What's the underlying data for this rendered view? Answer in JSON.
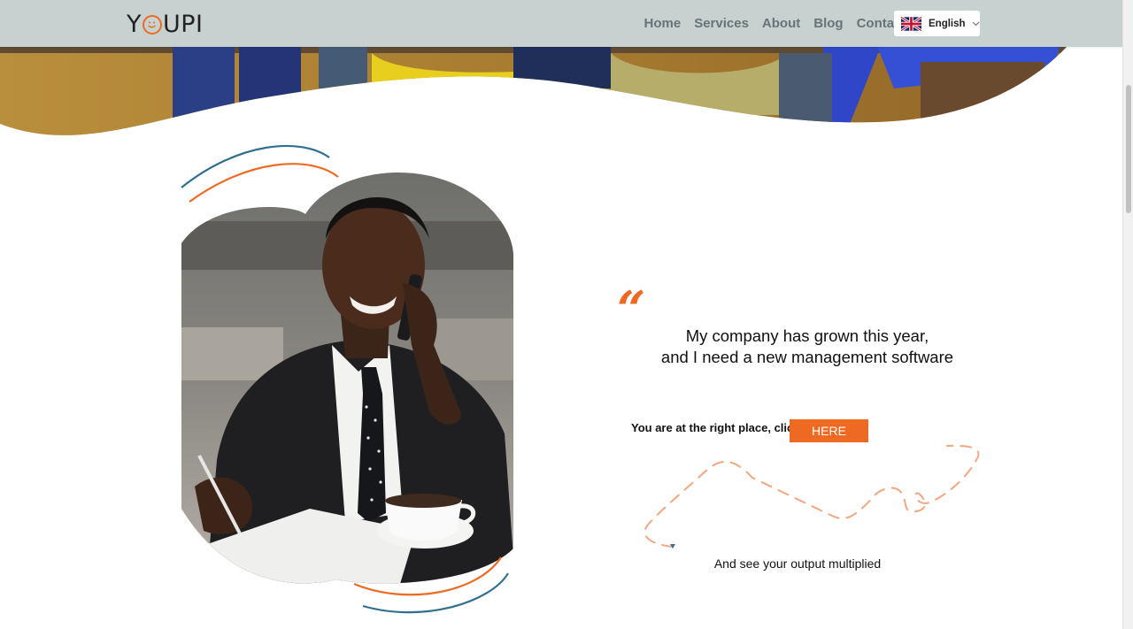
{
  "header": {
    "logo": {
      "text_before": "Y",
      "text_after": "UPI",
      "accent_color": "#ee6a23"
    },
    "nav": {
      "items": [
        {
          "label": "Home"
        },
        {
          "label": "Services"
        },
        {
          "label": "About"
        },
        {
          "label": "Blog"
        },
        {
          "label": "Contact"
        }
      ]
    },
    "language": {
      "label": "English",
      "flag_icon": "uk-flag-icon"
    }
  },
  "main": {
    "quote": {
      "mark": "“",
      "lines": [
        "My company has grown this year,",
        "and I need a new management software"
      ]
    },
    "cta": {
      "text": "You are at the right place, click",
      "button_label": "HERE"
    },
    "output_text": "And see your output multiplied"
  },
  "colors": {
    "accent": "#ee6a23",
    "header_bg": "#c7d2d0",
    "nav_text": "#667479",
    "arc_blue": "#2f6f8f"
  }
}
